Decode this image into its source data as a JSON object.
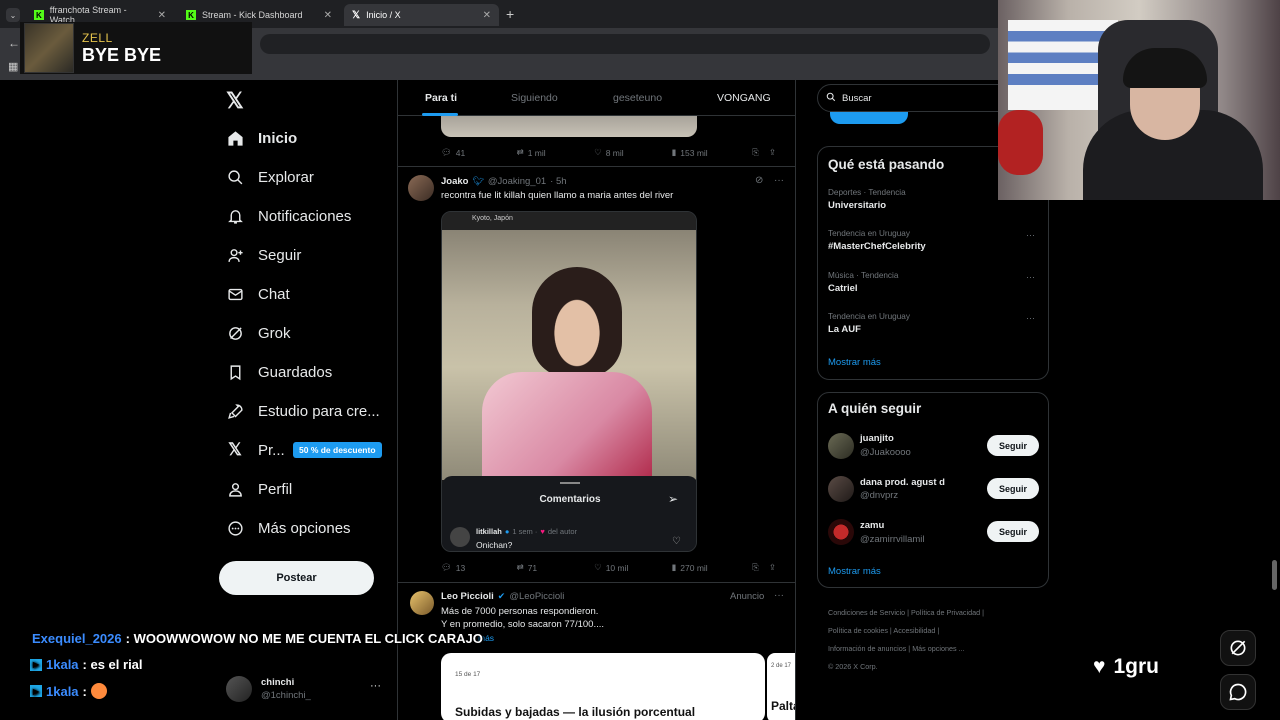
{
  "browser": {
    "tabs": [
      {
        "label": "ffranchota Stream - Watch"
      },
      {
        "label": "Stream - Kick Dashboard"
      },
      {
        "label": "Inicio / X"
      }
    ],
    "new_tab": "+"
  },
  "overlay_song": {
    "artist": "ZELL",
    "title": "BYE BYE"
  },
  "sidebar": {
    "items": [
      {
        "label": "Inicio",
        "icon": "home-icon"
      },
      {
        "label": "Explorar",
        "icon": "search-icon"
      },
      {
        "label": "Notificaciones",
        "icon": "bell-icon"
      },
      {
        "label": "Seguir",
        "icon": "add-user-icon"
      },
      {
        "label": "Chat",
        "icon": "mail-icon"
      },
      {
        "label": "Grok",
        "icon": "grok-icon"
      },
      {
        "label": "Guardados",
        "icon": "bookmark-icon"
      },
      {
        "label": "Estudio para cre...",
        "icon": "rocket-icon"
      },
      {
        "label": "Pr...",
        "icon": "x-logo-icon"
      },
      {
        "label": "Perfil",
        "icon": "user-icon"
      },
      {
        "label": "Más opciones",
        "icon": "more-icon"
      }
    ],
    "premium_badge": "50 % de descuento",
    "post_button": "Postear",
    "account": {
      "name": "chinchi",
      "handle": "@1chinchi_"
    }
  },
  "timeline": {
    "tabs": [
      "Para ti",
      "Siguiendo",
      "geseteuno",
      "VONGANG"
    ],
    "prev_tweet_actions": {
      "replies": "41",
      "reposts": "1 mil",
      "likes": "8 mil",
      "views": "153 mil"
    },
    "tweet": {
      "name": "Joako",
      "handle": "@Joaking_01",
      "time": "· 5h",
      "text": "recontra fue lit killah quien llamo a maria antes del river",
      "media_location": "Kyoto, Japón",
      "comments_title": "Comentarios",
      "comment_user": "litkillah",
      "comment_meta": "1 sem ·",
      "comment_author_tag": "del autor",
      "comment_text": "Onichan?",
      "actions": {
        "replies": "13",
        "reposts": "71",
        "likes": "10 mil",
        "views": "270 mil"
      }
    },
    "ad": {
      "name": "Leo Piccioli",
      "handle": "@LeoPiccioli",
      "label": "Anuncio",
      "line1": "Más de 7000 personas respondieron.",
      "line2": "Y en promedio, solo sacaron 77/100....",
      "more": "más",
      "card_date": "15 de 17",
      "card_title": "Subidas y bajadas — la ilusión porcentual",
      "card2_date": "2 de 17",
      "card2_title": "Palta"
    }
  },
  "right": {
    "search_placeholder": "Buscar",
    "trends_title": "Qué está pasando",
    "trends": [
      {
        "meta": "Deportes · Tendencia",
        "name": "Universitario"
      },
      {
        "meta": "Tendencia en Uruguay",
        "name": "#MasterChefCelebrity"
      },
      {
        "meta": "Música · Tendencia",
        "name": "Catriel"
      },
      {
        "meta": "Tendencia en Uruguay",
        "name": "La AUF"
      }
    ],
    "show_more": "Mostrar más",
    "who_title": "A quién seguir",
    "who": [
      {
        "name": "juanjito",
        "handle": "@Juakoooo",
        "button": "Seguir"
      },
      {
        "name": "dana prod. agust d",
        "handle": "@dnvprz",
        "button": "Seguir"
      },
      {
        "name": "zamu",
        "handle": "@zamirrvillamil",
        "button": "Seguir"
      }
    ],
    "who_more": "Mostrar más",
    "footer": [
      "Condiciones de Servicio",
      "Política de Privacidad",
      "Política de cookies",
      "Accesibilidad",
      "Información de anuncios",
      "Más opciones ...",
      "© 2026 X Corp."
    ]
  },
  "chat": [
    {
      "user": "Exequiel_2026",
      "text": ": WOOWWOWOW NO ME ME CUENTA EL CLICK CARAJO",
      "color": "#3b8cff"
    },
    {
      "user": "1kala",
      "text": ": es el rial",
      "color": "#3b8cff"
    },
    {
      "user": "1kala",
      "text": ":",
      "color": "#3b8cff"
    }
  ],
  "stream_overlay": {
    "followers_label": "1gru"
  },
  "colors": {
    "accent": "#1d9bf0",
    "kick_green": "#53fc18",
    "bg": "#000000"
  }
}
